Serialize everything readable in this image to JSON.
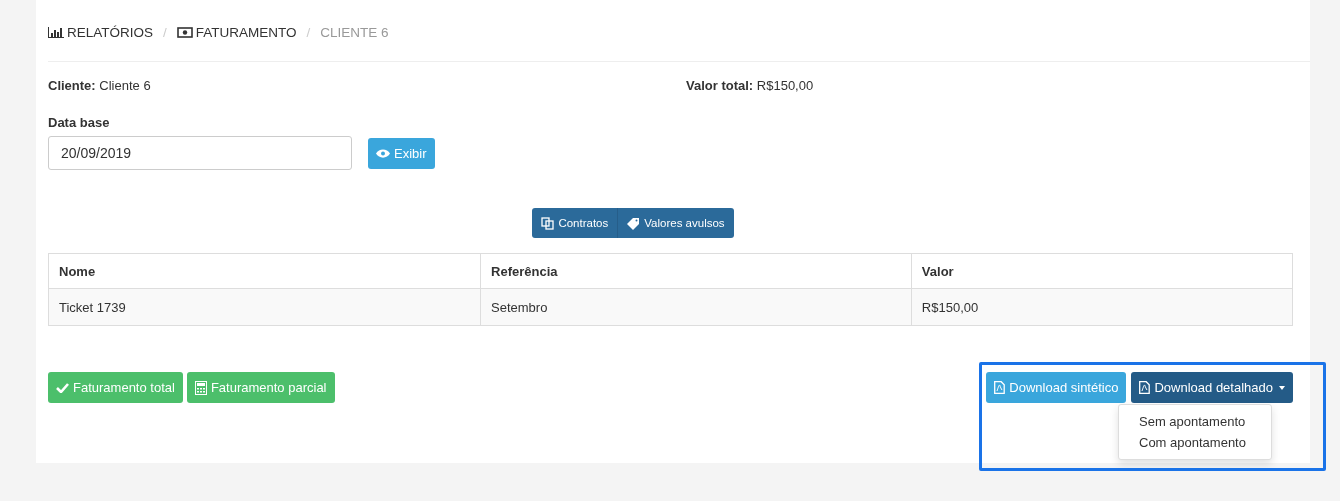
{
  "breadcrumb": [
    {
      "label": "RELATÓRIOS",
      "current": false
    },
    {
      "label": "FATURAMENTO",
      "current": false
    },
    {
      "label": "CLIENTE 6",
      "current": true
    }
  ],
  "breadcrumb_separators": [
    "/",
    "/"
  ],
  "summary": [
    {
      "label": "Cliente:",
      "value": "Cliente 6"
    },
    {
      "label": "Valor total:",
      "value": "R$150,00"
    }
  ],
  "date_field": {
    "label": "Data base",
    "value": "20/09/2019"
  },
  "show_button": "Exibir",
  "view_toggle": [
    {
      "label": "Contratos",
      "selected": false
    },
    {
      "label": "Valores avulsos",
      "selected": false
    }
  ],
  "table": {
    "columns": [
      "Nome",
      "Referência",
      "Valor"
    ],
    "rows": [
      [
        "Ticket 1739",
        "Setembro",
        "R$150,00"
      ]
    ]
  },
  "billing_buttons": [
    {
      "label": "Faturamento total"
    },
    {
      "label": "Faturamento parcial"
    }
  ],
  "download_buttons": [
    {
      "label": "Download sintético",
      "kind": "plain"
    },
    {
      "label": "Download detalhado",
      "kind": "dropdown",
      "expanded": true
    }
  ],
  "download_menu": [
    "Sem apontamento",
    "Com apontamento"
  ]
}
